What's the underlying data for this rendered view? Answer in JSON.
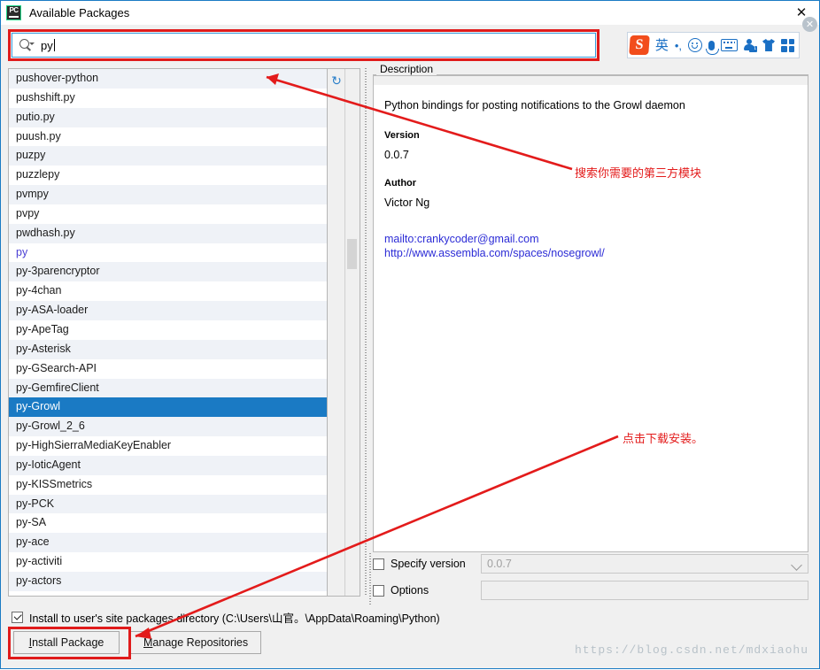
{
  "window": {
    "title": "Available Packages",
    "icon": "pycharm-icon",
    "close_label": "✕"
  },
  "search": {
    "value": "py",
    "icon": "search-icon"
  },
  "ime_toolbar": {
    "logo": "S",
    "mode_label": "英",
    "punctuation_label": "•,",
    "items": [
      "sogou-logo-icon",
      "english-mode-icon",
      "punctuation-icon",
      "emoji-icon",
      "voice-input-icon",
      "soft-keyboard-icon",
      "user-center-icon",
      "skin-icon",
      "toolbox-icon"
    ],
    "close_label": "✕"
  },
  "package_list": {
    "refresh_icon": "refresh-icon",
    "items": [
      {
        "name": "pushover-python",
        "state": "normal"
      },
      {
        "name": "pushshift.py",
        "state": "normal"
      },
      {
        "name": "putio.py",
        "state": "normal"
      },
      {
        "name": "puush.py",
        "state": "normal"
      },
      {
        "name": "puzpy",
        "state": "normal"
      },
      {
        "name": "puzzlepy",
        "state": "normal"
      },
      {
        "name": "pvmpy",
        "state": "normal"
      },
      {
        "name": "pvpy",
        "state": "normal"
      },
      {
        "name": "pwdhash.py",
        "state": "normal"
      },
      {
        "name": "py",
        "state": "installed"
      },
      {
        "name": "py-3parencryptor",
        "state": "normal"
      },
      {
        "name": "py-4chan",
        "state": "normal"
      },
      {
        "name": "py-ASA-loader",
        "state": "normal"
      },
      {
        "name": "py-ApeTag",
        "state": "normal"
      },
      {
        "name": "py-Asterisk",
        "state": "normal"
      },
      {
        "name": "py-GSearch-API",
        "state": "normal"
      },
      {
        "name": "py-GemfireClient",
        "state": "normal"
      },
      {
        "name": "py-Growl",
        "state": "selected"
      },
      {
        "name": "py-Growl_2_6",
        "state": "normal"
      },
      {
        "name": "py-HighSierraMediaKeyEnabler",
        "state": "normal"
      },
      {
        "name": "py-IoticAgent",
        "state": "normal"
      },
      {
        "name": "py-KISSmetrics",
        "state": "normal"
      },
      {
        "name": "py-PCK",
        "state": "normal"
      },
      {
        "name": "py-SA",
        "state": "normal"
      },
      {
        "name": "py-ace",
        "state": "normal"
      },
      {
        "name": "py-activiti",
        "state": "normal"
      },
      {
        "name": "py-actors",
        "state": "normal"
      }
    ]
  },
  "description": {
    "group_title": "Description",
    "summary": "Python bindings for posting notifications to the Growl daemon",
    "version_label": "Version",
    "version_value": "0.0.7",
    "author_label": "Author",
    "author_value": "Victor Ng",
    "links": [
      "mailto:crankycoder@gmail.com",
      "http://www.assembla.com/spaces/nosegrowl/"
    ],
    "link_color": "#2c2cd6"
  },
  "options": {
    "specify_version_label": "Specify version",
    "specify_version_checked": false,
    "specify_version_value": "0.0.7",
    "options_label": "Options",
    "options_checked": false,
    "options_value": ""
  },
  "footer": {
    "user_site_label": "Install to user's site packages directory (C:\\Users\\山官。\\AppData\\Roaming\\Python)",
    "user_site_checked": true,
    "install_button": "Install Package",
    "install_button_mnemonic": "I",
    "manage_button": "Manage Repositories",
    "manage_button_mnemonic": "M"
  },
  "annotations": {
    "note_search": "搜索你需要的第三方模块",
    "note_install": "点击下载安装。",
    "highlight_color": "#e01b1b"
  },
  "watermark": "https://blog.csdn.net/mdxiaohu"
}
